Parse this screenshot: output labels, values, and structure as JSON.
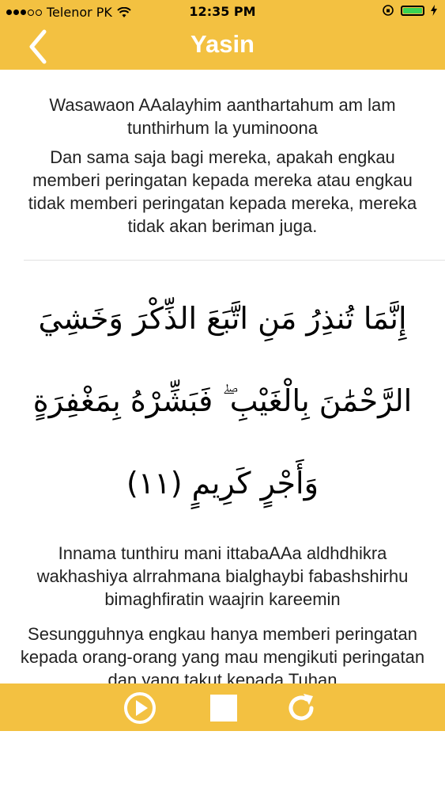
{
  "status_bar": {
    "carrier": "Telenor PK",
    "time": "12:35 PM"
  },
  "nav": {
    "title": "Yasin",
    "back_icon": "chevron-left-icon"
  },
  "verses": [
    {
      "transliteration": "Wasawaon AAalayhim aanthartahum am lam tunthirhum la yuminoona",
      "translation": "Dan sama saja bagi mereka, apakah engkau memberi peringatan kepada mereka atau engkau tidak memberi peringatan kepada mereka, mereka tidak akan beriman juga."
    },
    {
      "arabic": "إِنَّمَا تُنذِرُ مَنِ اتَّبَعَ الذِّكْرَ وَخَشِيَ الرَّحْمَٰنَ بِالْغَيْبِ ۖ فَبَشِّرْهُ بِمَغْفِرَةٍ وَأَجْرٍ كَرِيمٍ (١١)",
      "transliteration": "Innama tunthiru mani ittabaAAa aldhdhikra wakhashiya alrrahmana bialghaybi fabashshirhu bimaghfiratin waajrin kareemin",
      "translation": "Sesungguhnya engkau hanya memberi peringatan kepada orang-orang yang mau mengikuti peringatan dan yang takut kepada Tuhan"
    }
  ],
  "toolbar": {
    "play_icon": "play-icon",
    "stop_icon": "stop-icon",
    "repeat_icon": "repeat-icon"
  },
  "colors": {
    "accent": "#f3c141",
    "battery": "#39d353"
  }
}
